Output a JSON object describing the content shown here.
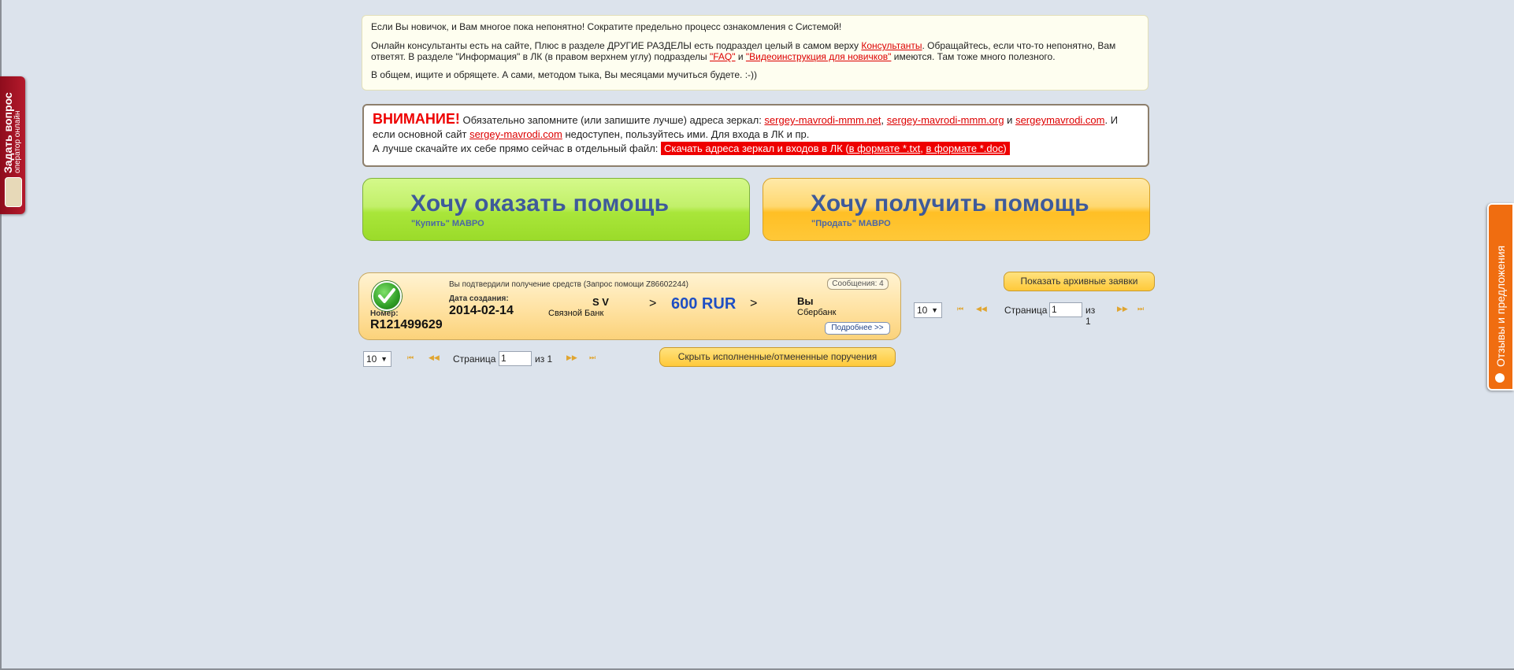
{
  "info": {
    "line1": "Если Вы новичок, и Вам многое пока непонятно! Сократите предельно процесс ознакомления с Системой!",
    "line2_a": "Онлайн консультанты есть на сайте, Плюс в разделе ДРУГИЕ РАЗДЕЛЫ есть подраздел целый в самом верху ",
    "line2_link": "Консультанты",
    "line2_b": ". Обращайтесь, если что-то непонятно, Вам ответят. В разделе \"Информация\" в ЛК (в правом верхнем углу) подразделы ",
    "faq_link": "\"FAQ\"",
    "and": " и ",
    "video_link": "\"Видеоинструкция для новичков\"",
    "line2_c": " имеются. Там тоже много полезного.",
    "line3": "В общем, ищите и обрящете. А сами, методом тыка, Вы месяцами мучиться будете. :-))"
  },
  "warning": {
    "attention": "ВНИМАНИЕ!",
    "text_a": " Обязательно запомните (или запишите лучше) адреса зеркал: ",
    "mirror1": "sergey-mavrodi-mmm.net",
    "comma": ", ",
    "mirror2": "sergey-mavrodi-mmm.org",
    "and": " и ",
    "mirror3": "sergeymavrodi.com",
    "text_b": ". И если основной сайт ",
    "main_site": "sergey-mavrodi.com",
    "text_c": " недоступен, пользуйтесь ими. Для входа в ЛК и пр.",
    "text_d": "А лучше скачайте их себе прямо сейчас в отдельный файл: ",
    "download_a": "Скачать адреса зеркал и входов в ЛК (",
    "txt_link": "в формате *.txt",
    "download_sep": ", ",
    "doc_link": "в формате *.doc",
    "download_b": ")"
  },
  "big_buttons": {
    "give": {
      "title": "Хочу оказать помощь",
      "subtitle": "\"Купить\" МАВРО"
    },
    "get": {
      "title": "Хочу получить помощь",
      "subtitle": "\"Продать\" МАВРО"
    }
  },
  "card": {
    "status": "Вы подтвердили получение средств (Запрос помощи Z86602244)",
    "messages": "Сообщения: 4",
    "number_label": "Номер:",
    "number": "R121499629",
    "date_label": "Дата создания:",
    "date": "2014-02-14",
    "sender_name": "S V",
    "sender_bank": "Связной Банк",
    "arrow": ">",
    "amount": "600 RUR",
    "receiver_name": "Вы",
    "receiver_bank": "Сбербанк",
    "details": "Подробнее >>"
  },
  "pager": {
    "page_size": "10",
    "page_label": "Страница",
    "page_value": "1",
    "of": "из 1",
    "first": "⏮",
    "prev": "◀◀",
    "next": "▶▶",
    "last": "⏭"
  },
  "buttons": {
    "archive": "Показать архивные заявки",
    "hide_done": "Скрыть исполненные/отмененные поручения"
  },
  "side_left": {
    "title": "Задать вопрос",
    "subtitle": "оператор онлайн"
  },
  "side_right": {
    "title": "Отзывы и предложения"
  },
  "colors": {
    "background": "#dce3ec",
    "alert_red": "#ee0000",
    "accent_blue": "#1e4fc4"
  }
}
